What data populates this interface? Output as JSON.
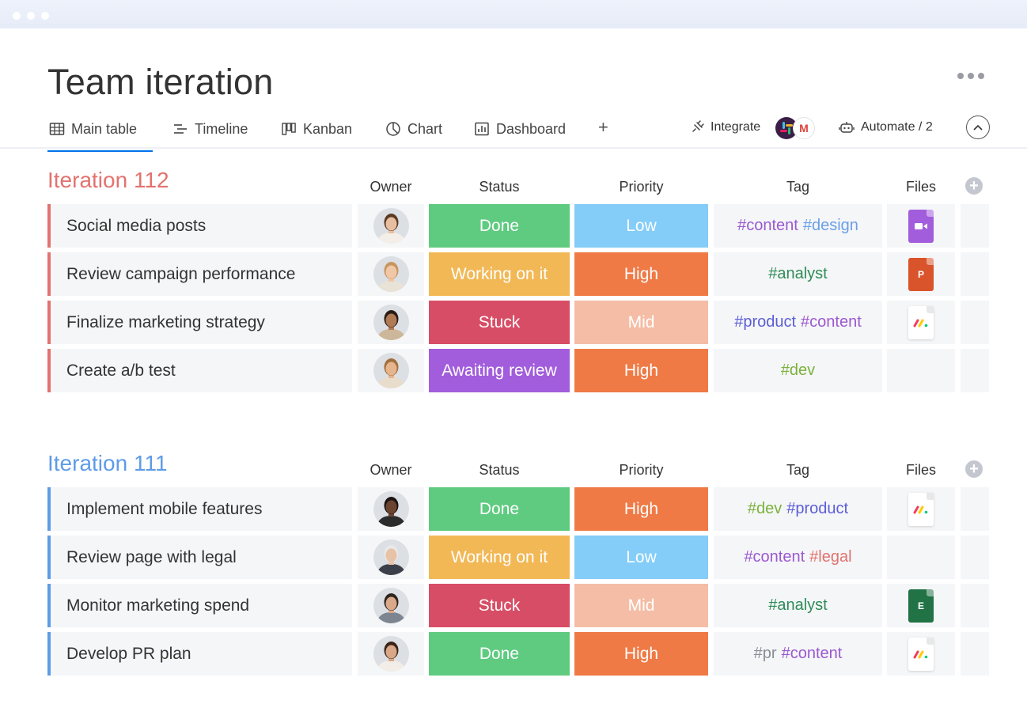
{
  "page": {
    "title": "Team iteration"
  },
  "tabs": [
    {
      "label": "Main table",
      "icon": "table-icon",
      "active": true
    },
    {
      "label": "Timeline",
      "icon": "timeline-icon"
    },
    {
      "label": "Kanban",
      "icon": "kanban-icon"
    },
    {
      "label": "Chart",
      "icon": "chart-pie-icon"
    },
    {
      "label": "Dashboard",
      "icon": "dashboard-icon"
    }
  ],
  "toolbar": {
    "add_view": "+",
    "integrate_label": "Integrate",
    "automate_label": "Automate / 2"
  },
  "columns": {
    "owner": "Owner",
    "status": "Status",
    "priority": "Priority",
    "tag": "Tag",
    "files": "Files"
  },
  "colors": {
    "accent": "#0073ea",
    "done": "#5fcb80",
    "working": "#f2b856",
    "stuck": "#d84d66",
    "awaiting": "#a25ddc",
    "low": "#83cdf8",
    "high": "#ef7a45",
    "mid": "#f5bda6",
    "group1": "#e2726e",
    "group2": "#5e9be8"
  },
  "groups": [
    {
      "title": "Iteration 112",
      "color": "#e2726e",
      "rows": [
        {
          "name": "Social media posts",
          "status": "Done",
          "status_color": "#5fcb80",
          "priority": "Low",
          "priority_color": "#83cdf8",
          "tags": [
            {
              "text": "#content",
              "color": "#9b59d0"
            },
            {
              "text": "#design",
              "color": "#6a9fe8"
            }
          ],
          "file": {
            "type": "video",
            "color": "#a25ddc",
            "icon": "video-file-icon"
          },
          "avatar": {
            "skin": "#e7bfa0",
            "hair": "#5a3a22",
            "shirt": "#f3efe8"
          }
        },
        {
          "name": "Review campaign performance",
          "status": "Working on it",
          "status_color": "#f2b856",
          "priority": "High",
          "priority_color": "#ef7a45",
          "tags": [
            {
              "text": "#analyst",
              "color": "#2e8b57"
            }
          ],
          "file": {
            "type": "ppt",
            "color": "#d9542a",
            "label": "P",
            "icon": "powerpoint-file-icon"
          },
          "avatar": {
            "skin": "#f0c8a8",
            "hair": "#c7955d",
            "shirt": "#e9e2d6"
          }
        },
        {
          "name": "Finalize marketing strategy",
          "status": "Stuck",
          "status_color": "#d84d66",
          "priority": "Mid",
          "priority_color": "#f5bda6",
          "tags": [
            {
              "text": "#product",
              "color": "#5b5ed6"
            },
            {
              "text": "#content",
              "color": "#9b59d0"
            }
          ],
          "file": {
            "type": "monday",
            "icon": "monday-file-icon"
          },
          "avatar": {
            "skin": "#b07a55",
            "hair": "#2a1c14",
            "shirt": "#cdb79a"
          }
        },
        {
          "name": "Create a/b test",
          "status": "Awaiting review",
          "status_color": "#a25ddc",
          "priority": "High",
          "priority_color": "#ef7a45",
          "tags": [
            {
              "text": "#dev",
              "color": "#7ab13c"
            }
          ],
          "file": null,
          "avatar": {
            "skin": "#e6b58e",
            "hair": "#a0703e",
            "shirt": "#e8dccb"
          }
        }
      ]
    },
    {
      "title": "Iteration 111",
      "color": "#5e9be8",
      "rows": [
        {
          "name": "Implement mobile features",
          "status": "Done",
          "status_color": "#5fcb80",
          "priority": "High",
          "priority_color": "#ef7a45",
          "tags": [
            {
              "text": "#dev",
              "color": "#7ab13c"
            },
            {
              "text": "#product",
              "color": "#5b5ed6"
            }
          ],
          "file": {
            "type": "monday",
            "icon": "monday-file-icon"
          },
          "avatar": {
            "skin": "#6b4430",
            "hair": "#1c1410",
            "shirt": "#2b2b2b"
          }
        },
        {
          "name": "Review page with legal",
          "status": "Working on it",
          "status_color": "#f2b856",
          "priority": "Low",
          "priority_color": "#83cdf8",
          "tags": [
            {
              "text": "#content",
              "color": "#9b59d0"
            },
            {
              "text": "#legal",
              "color": "#e2726e"
            }
          ],
          "file": null,
          "avatar": {
            "skin": "#e8c2a6",
            "hair": "#e8e8e8",
            "shirt": "#3a3f4a"
          }
        },
        {
          "name": "Monitor marketing spend",
          "status": "Stuck",
          "status_color": "#d84d66",
          "priority": "Mid",
          "priority_color": "#f5bda6",
          "tags": [
            {
              "text": "#analyst",
              "color": "#2e8b57"
            }
          ],
          "file": {
            "type": "excel",
            "color": "#217346",
            "label": "E",
            "icon": "excel-file-icon"
          },
          "avatar": {
            "skin": "#d9a98a",
            "hair": "#2e2420",
            "shirt": "#7d8590"
          }
        },
        {
          "name": "Develop PR plan",
          "status": "Done",
          "status_color": "#5fcb80",
          "priority": "High",
          "priority_color": "#ef7a45",
          "tags": [
            {
              "text": "#pr",
              "color": "#8a8d96"
            },
            {
              "text": "#content",
              "color": "#9b59d0"
            }
          ],
          "file": {
            "type": "monday",
            "icon": "monday-file-icon"
          },
          "avatar": {
            "skin": "#d8a888",
            "hair": "#3a2418",
            "shirt": "#f2ede6"
          }
        }
      ]
    }
  ]
}
